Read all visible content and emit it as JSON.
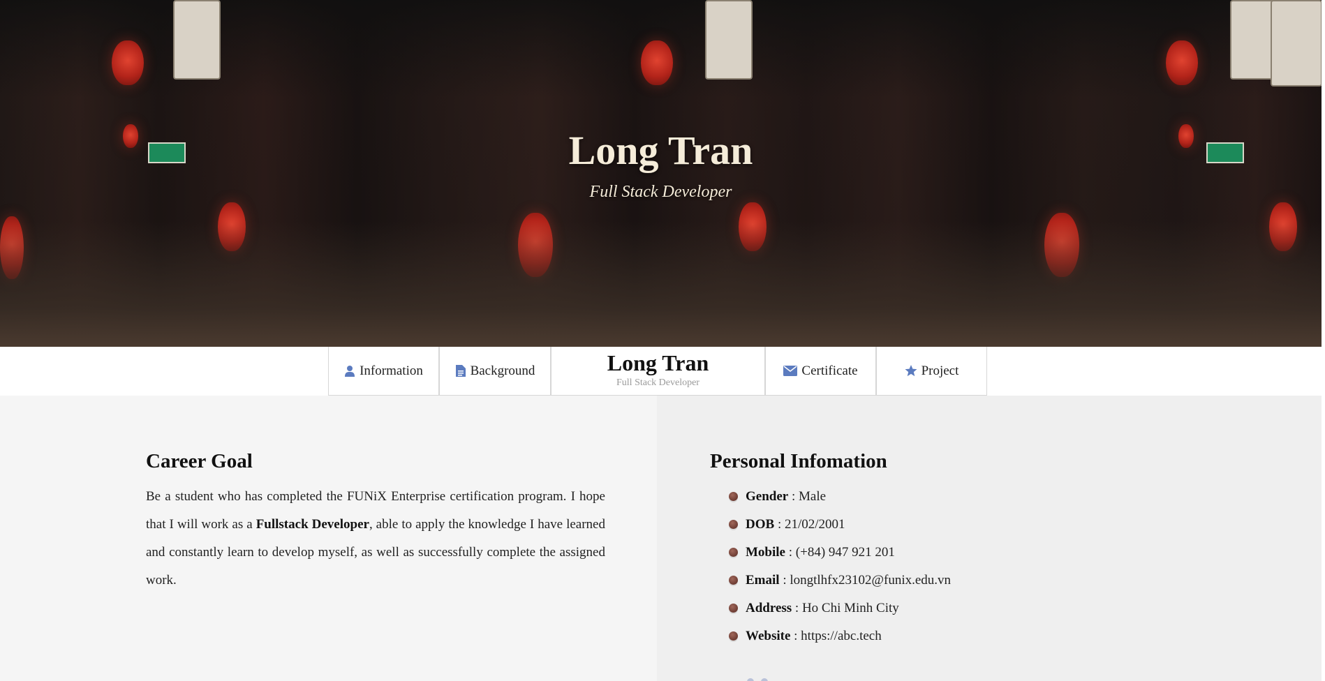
{
  "hero": {
    "name": "Long Tran",
    "role": "Full Stack Developer"
  },
  "nav": {
    "items": [
      {
        "label": "Information",
        "icon": "user-icon"
      },
      {
        "label": "Background",
        "icon": "document-icon"
      },
      {
        "label": "Certificate",
        "icon": "envelope-icon"
      },
      {
        "label": "Project",
        "icon": "star-icon"
      }
    ],
    "brand": {
      "name": "Long Tran",
      "tagline": "Full Stack Developer"
    },
    "icon_color": "#5b7bbf"
  },
  "career": {
    "title": "Career Goal",
    "text_before": "Be a student who has completed the FUNiX Enterprise certification program. I hope that I will work as a ",
    "highlight": "Fullstack Developer",
    "text_after": ", able to apply the knowledge I have learned and constantly learn to develop myself, as well as successfully complete the assigned work."
  },
  "personal": {
    "title": "Personal Infomation",
    "items": [
      {
        "label": "Gender",
        "value": "Male"
      },
      {
        "label": "DOB",
        "value": "21/02/2001"
      },
      {
        "label": "Mobile",
        "value": "(+84) 947 921 201"
      },
      {
        "label": "Email",
        "value": "longtlhfx23102@funix.edu.vn"
      },
      {
        "label": "Address",
        "value": "Ho Chi Minh City"
      },
      {
        "label": "Website",
        "value": "https://abc.tech"
      }
    ]
  },
  "colors": {
    "hero_text": "#f5ecd9",
    "bullet": "#6d3c33",
    "left_panel": "#f5f5f5",
    "right_panel": "#efefef"
  }
}
